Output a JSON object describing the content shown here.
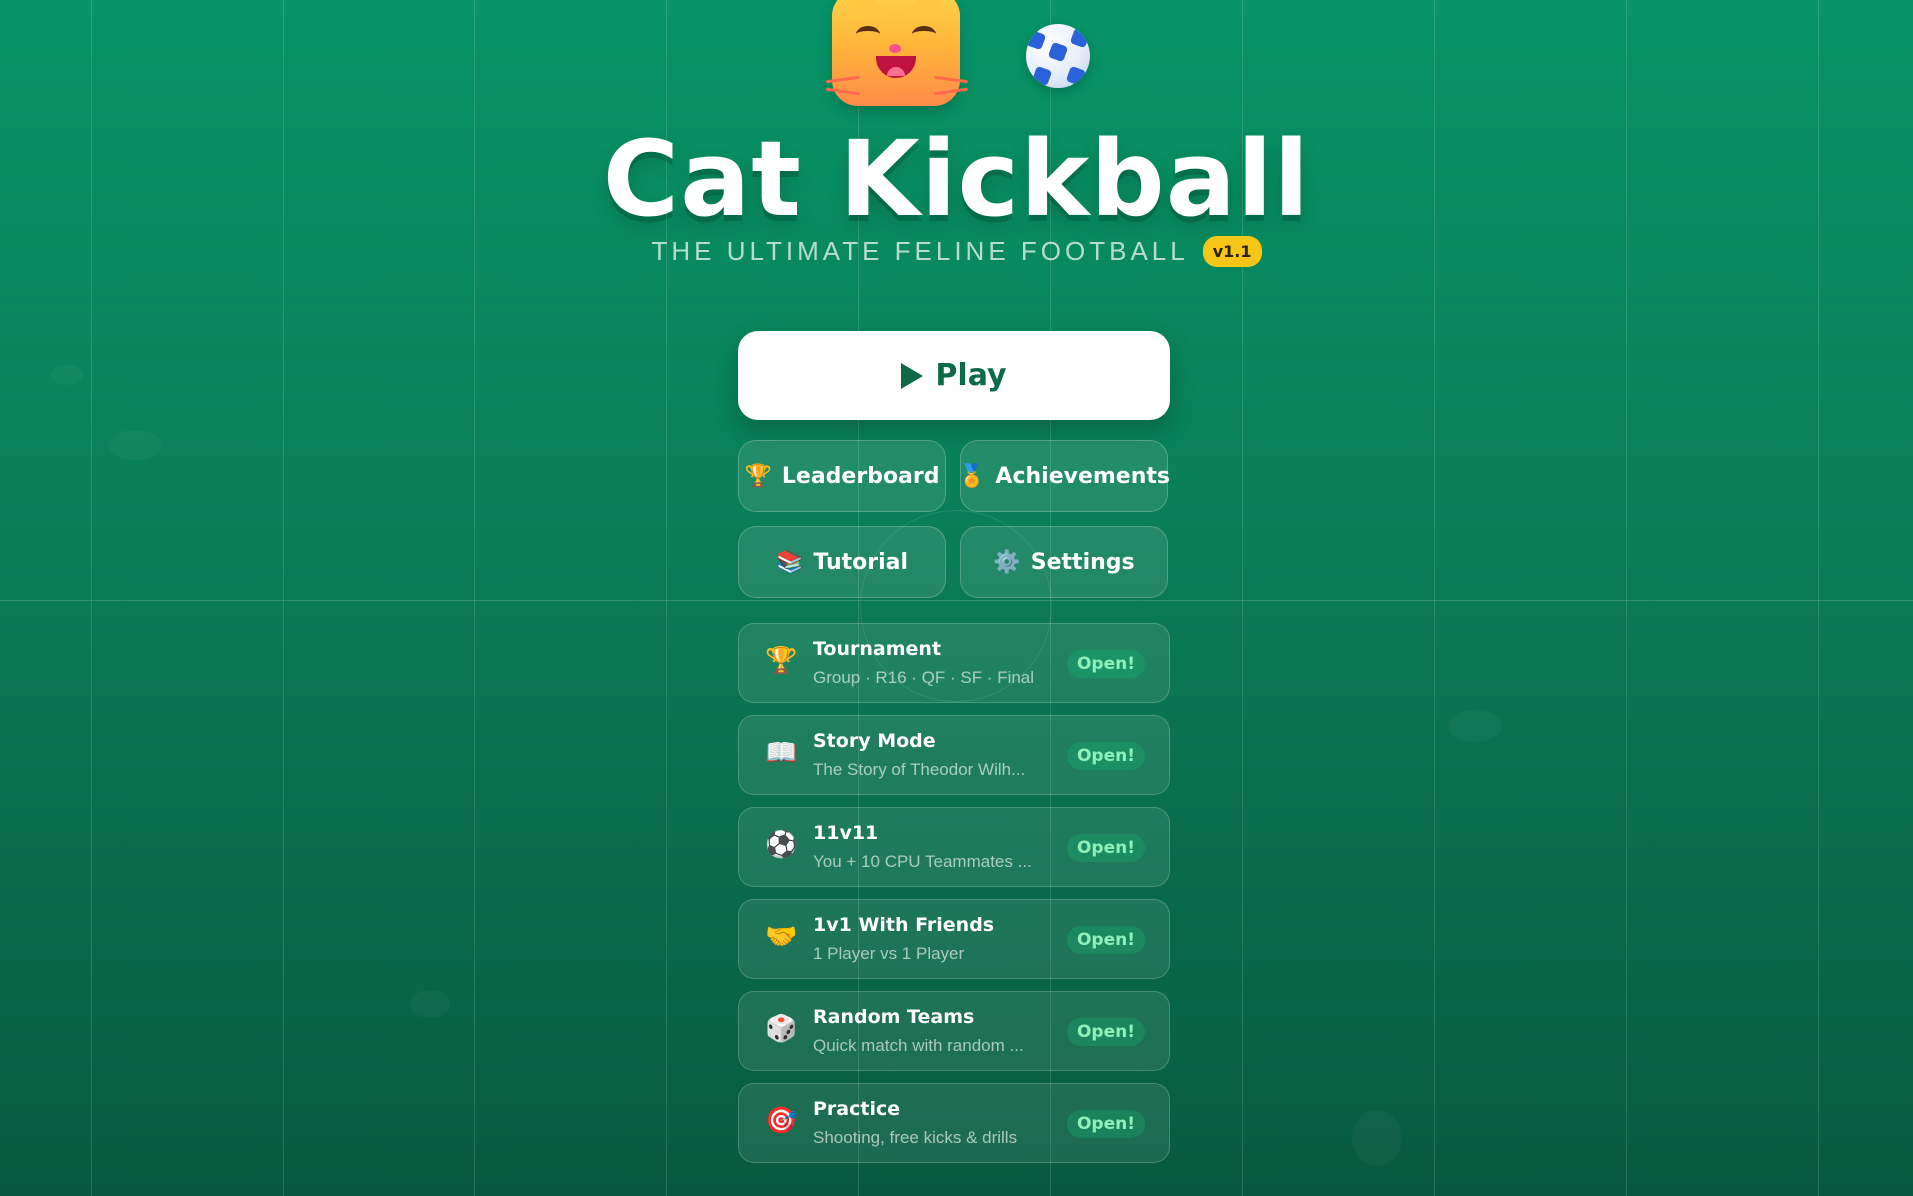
{
  "app": {
    "title": "Cat Kickball",
    "subtitle": "THE ULTIMATE FELINE FOOTBALL",
    "version": "v1.1"
  },
  "colors": {
    "background_top": "#079466",
    "background_bottom": "#075a3f",
    "play_text": "#0b6b47",
    "version_badge": "#f5c518",
    "open_badge_text": "#8ff0b8"
  },
  "header_icons": [
    "cat-face-icon",
    "soccer-ball-icon"
  ],
  "play_button": {
    "label": "Play",
    "icon": "play-triangle-icon"
  },
  "menu_buttons": [
    {
      "label": "Leaderboard",
      "icon": "🏆",
      "icon_name": "trophy-icon"
    },
    {
      "label": "Achievements",
      "icon": "🏅",
      "icon_name": "medal-icon"
    },
    {
      "label": "Tutorial",
      "icon": "📚",
      "icon_name": "books-icon"
    },
    {
      "label": "Settings",
      "icon": "⚙️",
      "icon_name": "gear-icon"
    }
  ],
  "modes": [
    {
      "title": "Tournament",
      "desc": "Group · R16 · QF · SF · Final",
      "badge": "Open!",
      "icon": "🏆",
      "icon_name": "trophy-icon"
    },
    {
      "title": "Story Mode",
      "desc": "The Story of Theodor Wilh...",
      "badge": "Open!",
      "icon": "📖",
      "icon_name": "open-book-icon"
    },
    {
      "title": "11v11",
      "desc": "You + 10 CPU Teammates ...",
      "badge": "Open!",
      "icon": "⚽",
      "icon_name": "soccer-ball-icon"
    },
    {
      "title": "1v1 With Friends",
      "desc": "1 Player vs 1 Player",
      "badge": "Open!",
      "icon": "🤝",
      "icon_name": "handshake-icon"
    },
    {
      "title": "Random Teams",
      "desc": "Quick match with random ...",
      "badge": "Open!",
      "icon": "🎲",
      "icon_name": "dice-icon"
    },
    {
      "title": "Practice",
      "desc": "Shooting, free kicks & drills",
      "badge": "Open!",
      "icon": "🎯",
      "icon_name": "target-icon"
    }
  ]
}
